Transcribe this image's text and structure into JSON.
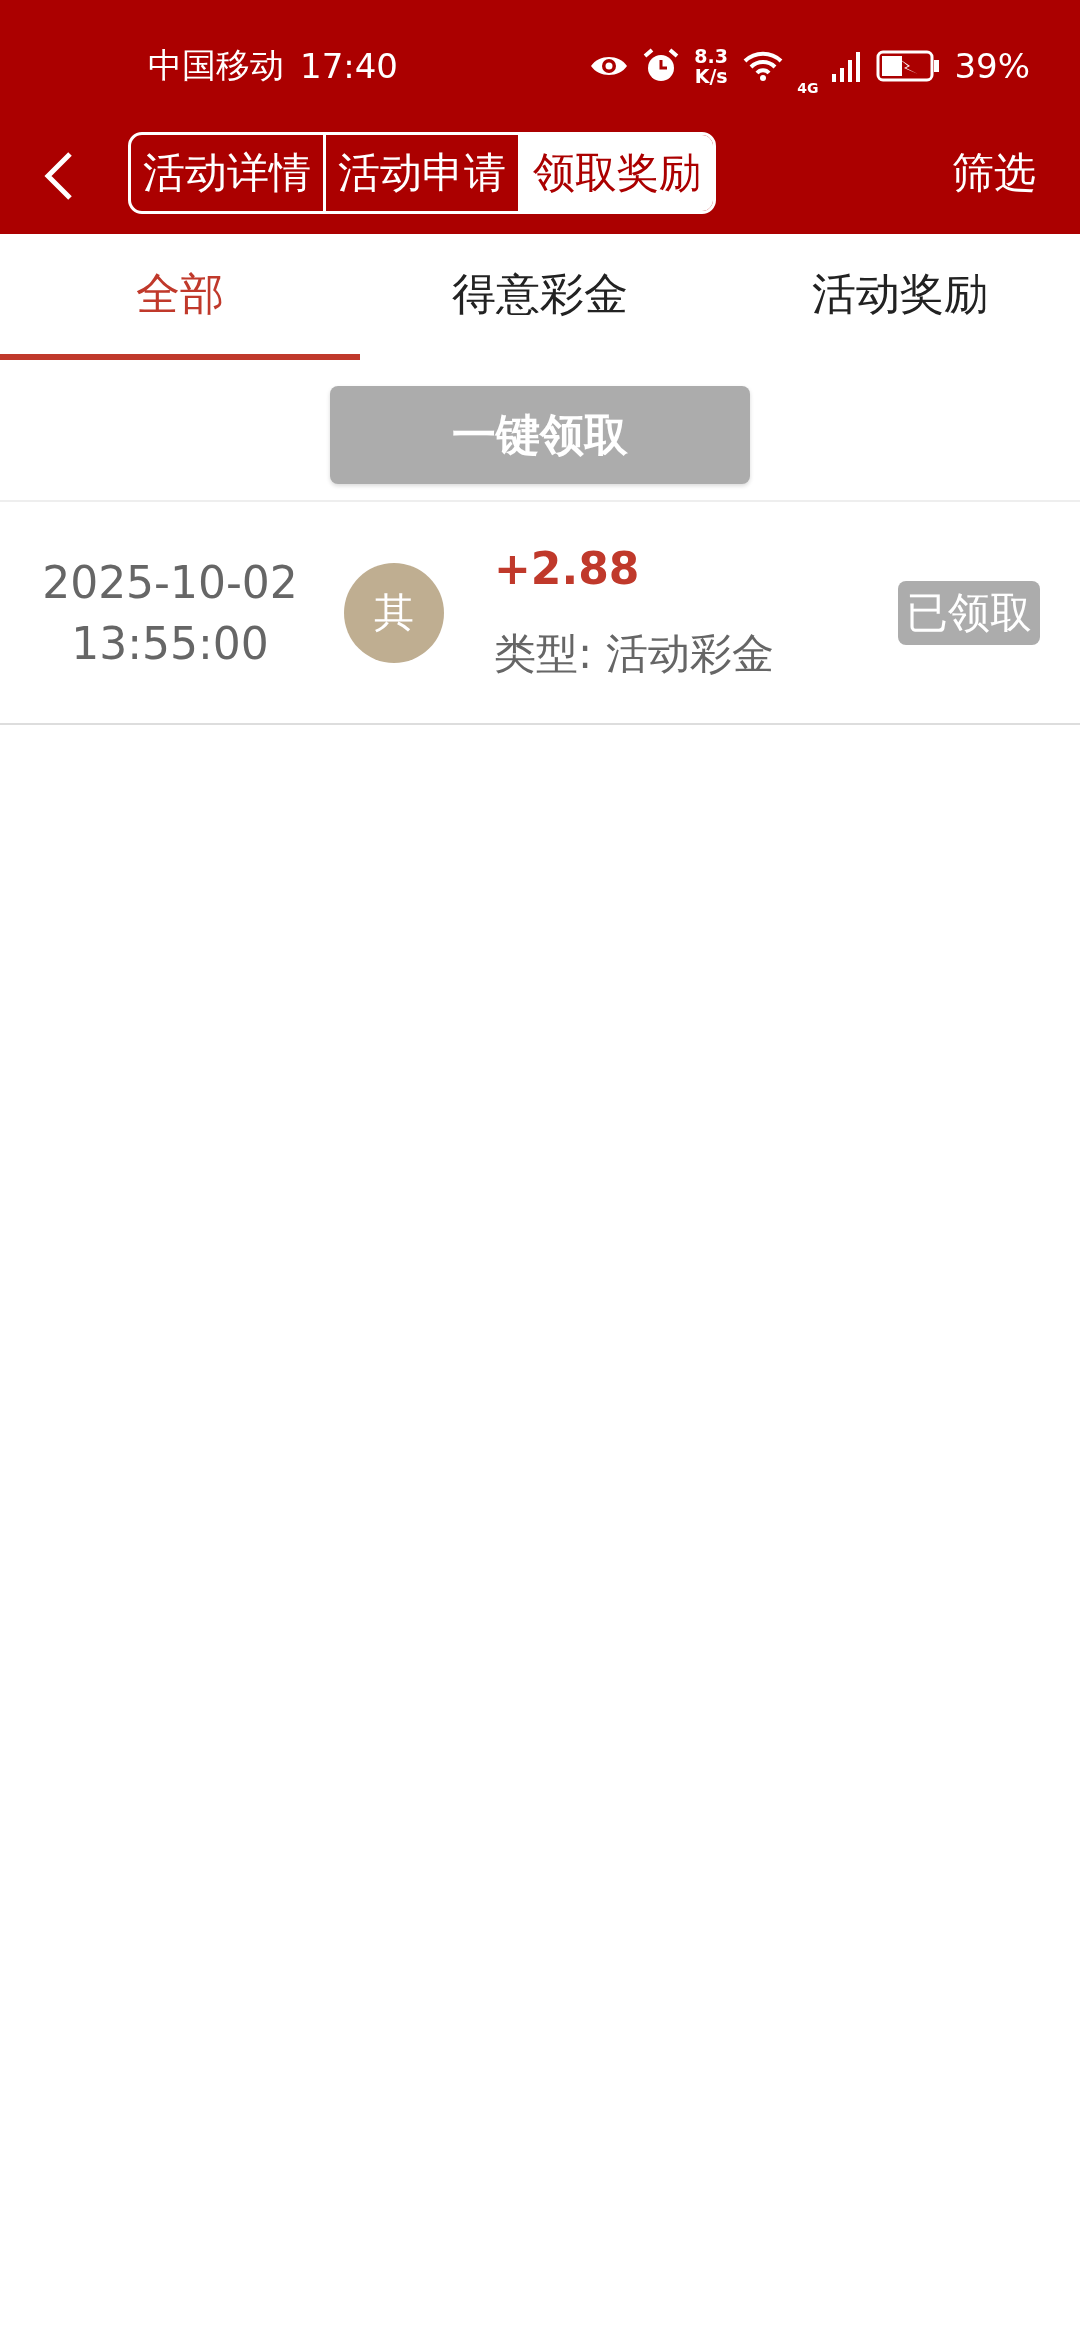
{
  "status_bar": {
    "carrier": "中国移动",
    "time": "17:40",
    "speed": "8.3 K/s",
    "network": "4G",
    "battery": "39%"
  },
  "header": {
    "segments": [
      {
        "label": "活动详情",
        "selected": false
      },
      {
        "label": "活动申请",
        "selected": false
      },
      {
        "label": "领取奖励",
        "selected": true
      }
    ],
    "filter": "筛选"
  },
  "tabs": [
    {
      "label": "全部",
      "selected": true
    },
    {
      "label": "得意彩金",
      "selected": false
    },
    {
      "label": "活动奖励",
      "selected": false
    }
  ],
  "claim_all_button": {
    "label": "一键领取",
    "disabled": true
  },
  "records": [
    {
      "date": "2025-10-02",
      "time": "13:55:00",
      "avatar": "其",
      "amount": "+2.88",
      "type": "类型: 活动彩金",
      "status": "已领取",
      "claimed": true
    }
  ]
}
